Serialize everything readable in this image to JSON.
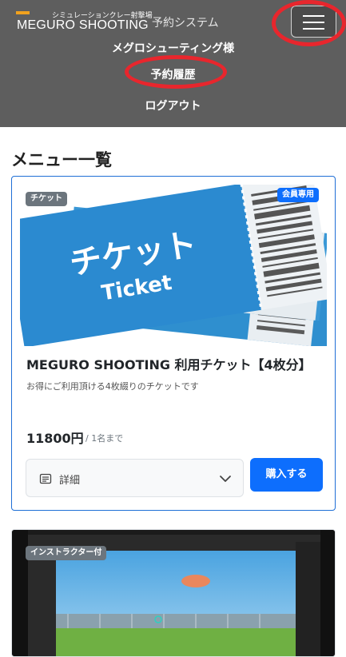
{
  "header": {
    "logo_main": "MEGURO SHOOTING",
    "logo_sub": "シミュレーションクレー射撃場",
    "system_label": "予約システム",
    "menu_icon": "hamburger-icon",
    "accent_color": "#f0a11e",
    "highlight_color": "#e8262d"
  },
  "nav": {
    "user": "メグロシューティング様",
    "history": "予約履歴",
    "logout": "ログアウト"
  },
  "section_title": "メニュー一覧",
  "cards": [
    {
      "badge": "チケット",
      "member_badge": "会員専用",
      "image_text_ja": "チケット",
      "image_text_en": "Ticket",
      "title": "MEGURO SHOOTING 利用チケット【4枚分】",
      "description": "お得にご利用頂ける4枚綴りのチケットです",
      "price": "11800円",
      "price_unit": "/ 1名まで",
      "detail_label": "詳細",
      "buy_label": "購入する",
      "button_color": "#0d6efd"
    },
    {
      "badge": "インストラクター付"
    }
  ]
}
